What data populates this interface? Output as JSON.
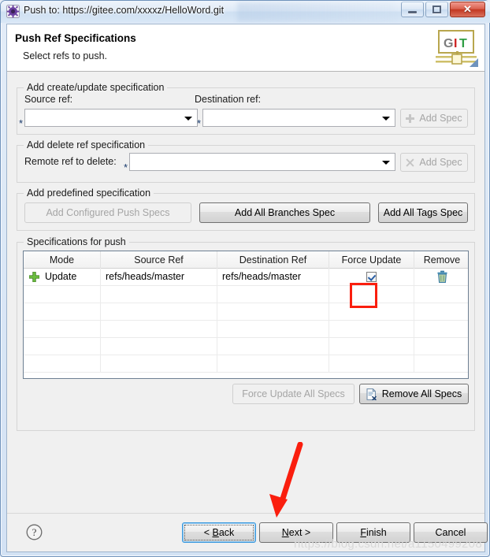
{
  "window": {
    "title": "Push to: https://gitee.com/xxxxz/HelloWord.git",
    "icon": "gear-icon",
    "controls": {
      "minimize": "Minimize",
      "maximize": "Maximize",
      "close": "✕"
    }
  },
  "wizard": {
    "title": "Push Ref Specifications",
    "subtitle": "Select refs to push.",
    "logo": {
      "letters": [
        "G",
        "I",
        "T"
      ],
      "colors": [
        "#7d7d7d",
        "#cc2222",
        "#2f9e44"
      ]
    }
  },
  "create_update_group": {
    "title": "Add create/update specification",
    "source_label": "Source ref:",
    "destination_label": "Destination ref:",
    "source_value": "",
    "destination_value": "",
    "required_marker": "*",
    "add_spec_label": "Add Spec",
    "add_spec_icon": "plus-icon",
    "add_spec_enabled": false
  },
  "delete_group": {
    "title": "Add delete ref specification",
    "remote_label": "Remote ref to delete:",
    "remote_value": "",
    "required_marker": "*",
    "add_spec_label": "Add Spec",
    "add_spec_icon": "cross-icon",
    "add_spec_enabled": false
  },
  "predefined_group": {
    "title": "Add predefined specification",
    "buttons": [
      {
        "label": "Add Configured Push Specs",
        "enabled": false
      },
      {
        "label": "Add All Branches Spec",
        "enabled": true
      },
      {
        "label": "Add All Tags Spec",
        "enabled": true
      }
    ]
  },
  "specs_group": {
    "title": "Specifications for push",
    "columns": [
      "Mode",
      "Source Ref",
      "Destination Ref",
      "Force Update",
      "Remove"
    ],
    "rows": [
      {
        "mode_icon": "green-plus-icon",
        "mode": "Update",
        "source_ref": "refs/heads/master",
        "destination_ref": "refs/heads/master",
        "force_update": true,
        "remove_icon": "trash-icon"
      }
    ],
    "empty_row_count": 6,
    "footer_buttons": [
      {
        "label": "Force Update All Specs",
        "enabled": false,
        "icon": ""
      },
      {
        "label": "Remove All Specs",
        "enabled": true,
        "icon": "remove-doc-icon"
      }
    ]
  },
  "dialog_buttons": [
    {
      "label": "< Back",
      "mnemonic": "B",
      "focused": true,
      "enabled": true
    },
    {
      "label": "Next >",
      "mnemonic": "N",
      "focused": false,
      "enabled": true
    },
    {
      "label": "Finish",
      "mnemonic": "F",
      "focused": false,
      "enabled": true
    },
    {
      "label": "Cancel",
      "mnemonic": "",
      "focused": false,
      "enabled": true
    }
  ],
  "help_icon": "question-mark-icon",
  "annotations": {
    "highlight_box_color": "#fa1e0e",
    "arrow_color": "#fa1e0e",
    "arrow_target": "Next >"
  },
  "watermark": "https://blog.csdn.net/a1150499208"
}
